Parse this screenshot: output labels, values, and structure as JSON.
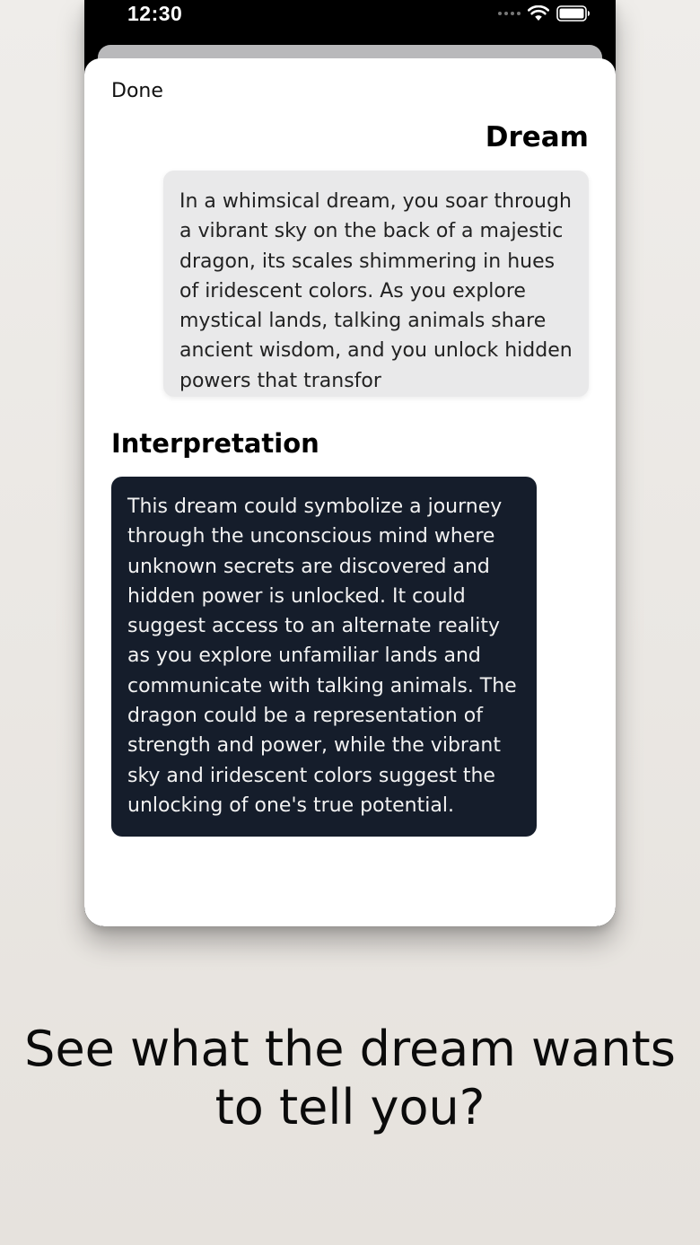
{
  "status_bar": {
    "time": "12:30"
  },
  "sheet": {
    "done_label": "Done",
    "dream_title": "Dream",
    "dream_text": "In a whimsical dream, you soar through a vibrant sky on the back of a majestic dragon, its scales shimmering in hues of iridescent colors. As you explore mystical lands, talking animals share ancient wisdom, and you unlock hidden powers that transfor",
    "interpretation_title": "Interpretation",
    "interpretation_text": "This dream could symbolize a journey through the unconscious mind where unknown secrets are discovered and hidden power is unlocked. It could suggest access to an alternate reality as you explore unfamiliar lands and communicate with talking animals. The dragon could be a representation of strength and power, while the vibrant sky and iridescent colors suggest the unlocking of one's true potential."
  },
  "tagline": "See what the dream wants to tell you?",
  "colors": {
    "interpretation_bg": "#151d2b",
    "dream_bg": "#e9e9ea",
    "background": "#efedea"
  },
  "icons": [
    "cellular-signal-icon",
    "wifi-icon",
    "battery-icon"
  ]
}
